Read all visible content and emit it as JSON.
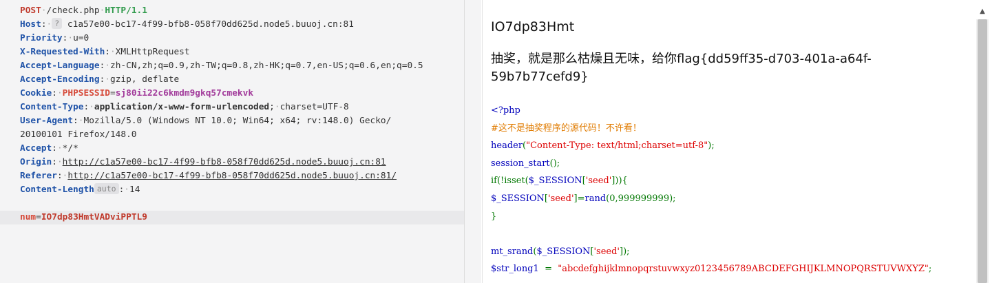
{
  "request": {
    "method": "POST",
    "path": "/check.php",
    "version": "HTTP/1.1",
    "headers": [
      {
        "name": "Host",
        "badge": "?",
        "value": "c1a57e00-bc17-4f99-bfb8-058f70dd625d.node5.buuoj.cn:81"
      },
      {
        "name": "Priority",
        "value": "u=0"
      },
      {
        "name": "X-Requested-With",
        "value": "XMLHttpRequest"
      },
      {
        "name": "Accept-Language",
        "value": "zh-CN,zh;q=0.9,zh-TW;q=0.8,zh-HK;q=0.7,en-US;q=0.6,en;q=0.5"
      },
      {
        "name": "Accept-Encoding",
        "value": "gzip, deflate"
      },
      {
        "name": "Cookie",
        "cookie_name": "PHPSESSID",
        "cookie_value": "sj80ii22c6kmdm9gkq57cmekvk"
      },
      {
        "name": "Content-Type",
        "value_bold": "application/x-www-form-urlencoded",
        "value_rest": "charset=UTF-8"
      },
      {
        "name": "User-Agent",
        "value_line1": "Mozilla/5.0 (Windows NT 10.0; Win64; x64; rv:148.0) Gecko/",
        "value_line2": "20100101 Firefox/148.0"
      },
      {
        "name": "Accept",
        "value": "*/*"
      },
      {
        "name": "Origin",
        "value": "http://c1a57e00-bc17-4f99-bfb8-058f70dd625d.node5.buuoj.cn:81"
      },
      {
        "name": "Referer",
        "value": "http://c1a57e00-bc17-4f99-bfb8-058f70dd625d.node5.buuoj.cn:81/"
      },
      {
        "name": "Content-Length",
        "badge": "auto",
        "value": "14"
      }
    ],
    "body_param_name": "num",
    "body_param_value": "IO7dp83HmtVADviPPTL9"
  },
  "response": {
    "title": "IO7dp83Hmt",
    "message": "抽奖，就是那么枯燥且无味，给你flag{dd59ff35-d703-401a-a64f-59b7b77cefd9}",
    "code": {
      "l1": "<?php",
      "l2": "#这不是抽奖程序的源代码！不许看！",
      "l3_fn": "header",
      "l3_open": "(",
      "l3_str": "\"Content-Type:  text/html;charset=utf-8\"",
      "l3_close": ");",
      "l4_fn": "session_start",
      "l4_rest": "();",
      "l5_a": "if(!isset(",
      "l5_var": "$_SESSION",
      "l5_b": "[",
      "l5_key": "'seed'",
      "l5_c": "])){",
      "l6_var": "$_SESSION",
      "l6_b": "[",
      "l6_key": "'seed'",
      "l6_c": "]=",
      "l6_fn": "rand",
      "l6_d": "(0,999999999);",
      "l7": "}",
      "l9_fn": "mt_srand",
      "l9_a": "(",
      "l9_var": "$_SESSION",
      "l9_b": "[",
      "l9_key": "'seed'",
      "l9_c": "]);",
      "l10_var": "$str_long1",
      "l10_eq": "  =  ",
      "l10_str": "\"abcdefghijklmnopqrstuvwxyz0123456789ABCDEFGHIJKLMNOPQRSTUVWXYZ\"",
      "l10_end": ";"
    }
  },
  "colors": {
    "header_name": "#2053a8",
    "method": "#c0392b",
    "version": "#2f9a4b",
    "cookie": "#a23b9b"
  }
}
